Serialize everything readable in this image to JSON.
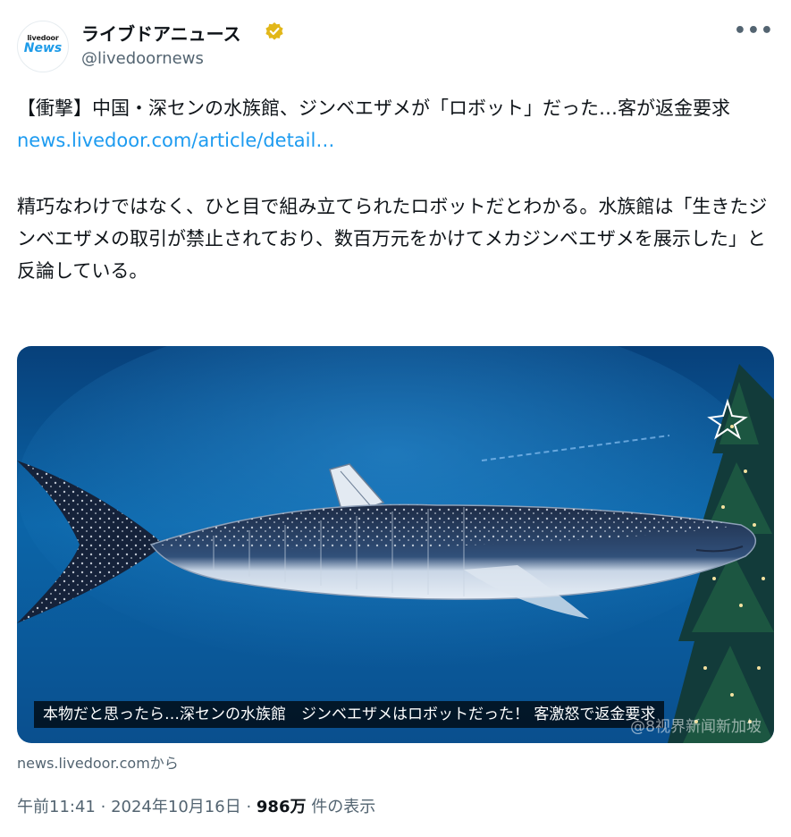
{
  "account": {
    "avatar_small": "livedoor",
    "avatar_big": "News",
    "name": "ライブドアニュース",
    "handle": "@livedoornews",
    "verified": true,
    "more_icon": "more-dots-icon"
  },
  "tweet": {
    "line1": "【衝撃】中国・深センの水族館、ジンベエザメが「ロボット」だった…客が返金要求",
    "link": "news.livedoor.com/article/detail…",
    "line2": "精巧なわけではなく、ひと目で組み立てられたロボットだとわかる。水族館は「生きたジンベエザメの取引が禁止されており、数百万元をかけてメカジンベエザメを展示した」と反論している。"
  },
  "media": {
    "caption": "本物だと思ったら…深センの水族館　ジンベエザメはロボットだった！ 客激怒で返金要求",
    "watermark": "@8视界新闻新加坡"
  },
  "card_source": "news.livedoor.comから",
  "meta": {
    "time": "午前11:41",
    "date": "2024年10月16日",
    "sep": "·",
    "views": "986万",
    "views_label": "件の表示"
  },
  "colors": {
    "link": "#1d9bf0",
    "badge": "#e2b719",
    "secondary": "#536471"
  }
}
